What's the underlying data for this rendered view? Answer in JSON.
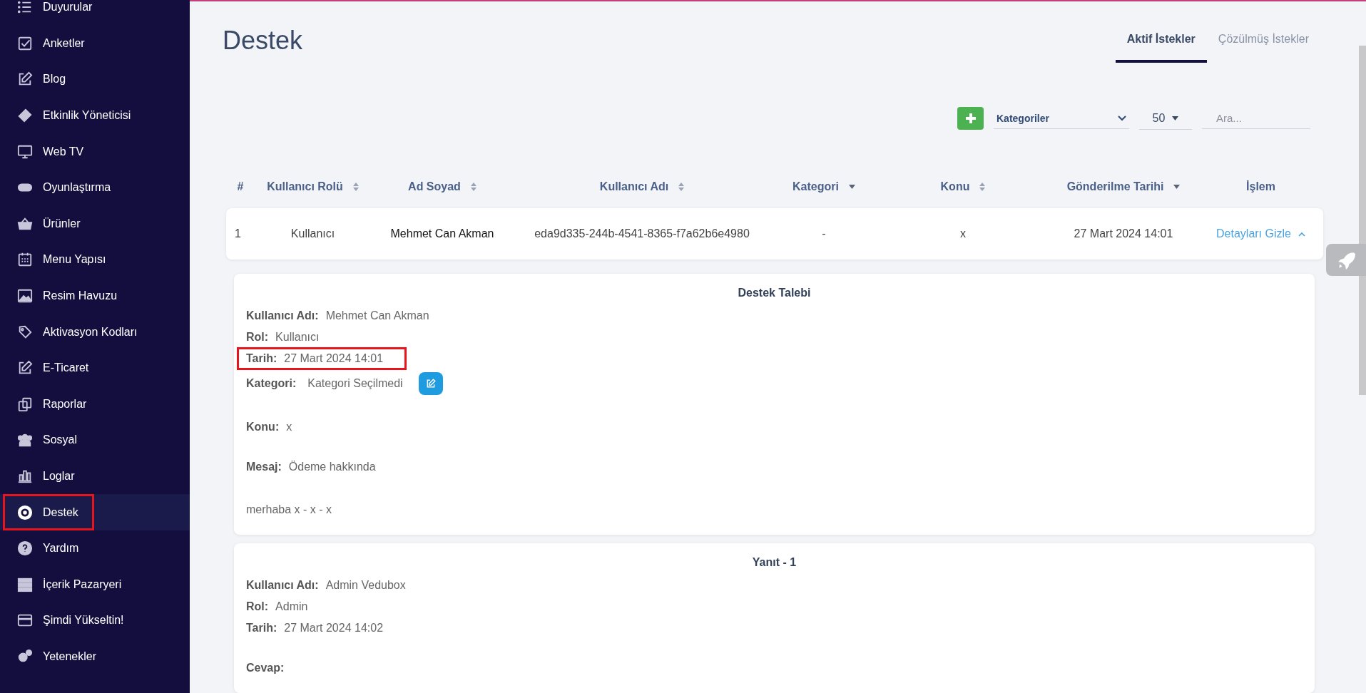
{
  "sidebar": {
    "items": [
      {
        "label": "Duyurular",
        "selected": false,
        "highlighted": false
      },
      {
        "label": "Anketler",
        "selected": false,
        "highlighted": false
      },
      {
        "label": "Blog",
        "selected": false,
        "highlighted": false
      },
      {
        "label": "Etkinlik Yöneticisi",
        "selected": false,
        "highlighted": false
      },
      {
        "label": "Web TV",
        "selected": false,
        "highlighted": false
      },
      {
        "label": "Oyunlaştırma",
        "selected": false,
        "highlighted": false
      },
      {
        "label": "Ürünler",
        "selected": false,
        "highlighted": false
      },
      {
        "label": "Menu Yapısı",
        "selected": false,
        "highlighted": false
      },
      {
        "label": "Resim Havuzu",
        "selected": false,
        "highlighted": false
      },
      {
        "label": "Aktivasyon Kodları",
        "selected": false,
        "highlighted": false
      },
      {
        "label": "E-Ticaret",
        "selected": false,
        "highlighted": false
      },
      {
        "label": "Raporlar",
        "selected": false,
        "highlighted": false
      },
      {
        "label": "Sosyal",
        "selected": false,
        "highlighted": false
      },
      {
        "label": "Loglar",
        "selected": false,
        "highlighted": false
      },
      {
        "label": "Destek",
        "selected": true,
        "highlighted": true
      },
      {
        "label": "Yardım",
        "selected": false,
        "highlighted": false
      },
      {
        "label": "İçerik Pazaryeri",
        "selected": false,
        "highlighted": false
      },
      {
        "label": "Şimdi Yükseltin!",
        "selected": false,
        "highlighted": false
      },
      {
        "label": "Yetenekler",
        "selected": false,
        "highlighted": false
      }
    ]
  },
  "page_title": "Destek",
  "tabs": [
    {
      "label": "Aktif İstekler",
      "selected": true
    },
    {
      "label": "Çözülmüş İstekler",
      "selected": false
    }
  ],
  "toolbar": {
    "category_select": {
      "value": "Kategoriler"
    },
    "page_size_select": {
      "value": "50"
    },
    "search": {
      "placeholder": "Ara..."
    }
  },
  "table": {
    "columns": [
      {
        "label": "#",
        "kind": "plain"
      },
      {
        "label": "Kullanıcı Rolü",
        "kind": "sortable"
      },
      {
        "label": "Ad Soyad",
        "kind": "sortable"
      },
      {
        "label": "Kullanıcı Adı",
        "kind": "sortable"
      },
      {
        "label": "Kategori",
        "kind": "dropdown"
      },
      {
        "label": "Konu",
        "kind": "sortable"
      },
      {
        "label": "Gönderilme Tarihi",
        "kind": "dropdown"
      },
      {
        "label": "İşlem",
        "kind": "plain"
      }
    ],
    "rows": [
      {
        "cells": [
          "1",
          "Kullanıcı",
          "Mehmet Can Akman",
          "eda9d335-244b-4541-8365-f7a62b6e4980",
          "-",
          "x",
          "27 Mart 2024 14:01"
        ],
        "action": "Detayları Gizle",
        "expanded": true
      }
    ]
  },
  "detail_cards": [
    {
      "title": "Destek Talebi",
      "fields": [
        {
          "kind": "info",
          "label": "Kullanıcı Adı:",
          "value": "Mehmet Can Akman",
          "highlighted": false
        },
        {
          "kind": "info",
          "label": "Rol:",
          "value": "Kullanıcı",
          "highlighted": false
        },
        {
          "kind": "info",
          "label": "Tarih:",
          "value": "27 Mart 2024 14:01",
          "highlighted": true
        },
        {
          "kind": "category",
          "label": "Kategori:",
          "value": "Kategori Seçilmedi",
          "highlighted": false
        },
        {
          "kind": "section",
          "label": "Konu:",
          "value": "x",
          "highlighted": false
        },
        {
          "kind": "section",
          "label": "Mesaj:",
          "value": "Ödeme hakkında",
          "highlighted": false
        },
        {
          "kind": "body",
          "value": "merhaba x - x - x",
          "highlighted": false
        }
      ]
    },
    {
      "title": "Yanıt - 1",
      "fields": [
        {
          "kind": "info",
          "label": "Kullanıcı Adı:",
          "value": "Admin Vedubox",
          "highlighted": false
        },
        {
          "kind": "info",
          "label": "Rol:",
          "value": "Admin",
          "highlighted": false
        },
        {
          "kind": "info",
          "label": "Tarih:",
          "value": "27 Mart 2024 14:02",
          "highlighted": false
        },
        {
          "kind": "section",
          "label": "Cevap:",
          "highlighted": false
        }
      ]
    }
  ]
}
